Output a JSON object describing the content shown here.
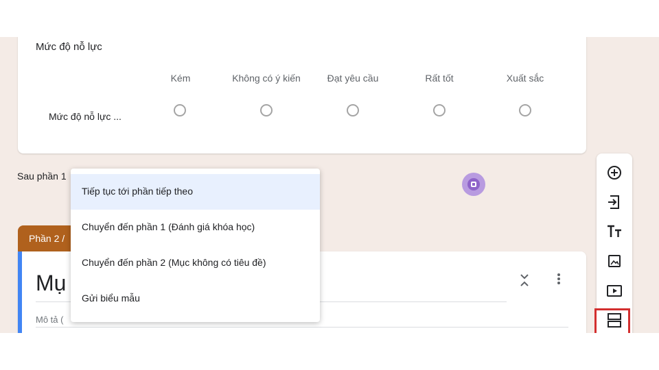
{
  "question": {
    "title": "Mức độ nỗ lực",
    "columns": [
      "Kém",
      "Không có ý kiến",
      "Đạt yêu cầu",
      "Rất tốt",
      "Xuất sắc"
    ],
    "row_label": "Mức độ nỗ lực ..."
  },
  "after_section_label": "Sau phần 1",
  "dropdown": {
    "options": [
      "Tiếp tục tới phần tiếp theo",
      "Chuyển đến phần 1 (Đánh giá khóa học)",
      "Chuyển đến phần 2 (Mục không có tiêu đề)",
      "Gửi biểu mẫu"
    ],
    "selected_index": 0
  },
  "section": {
    "tab_label": "Phần 2 /",
    "title": "Mụ",
    "description": "Mô tả ("
  },
  "toolbar": {
    "tools": [
      "add-question-icon",
      "import-questions-icon",
      "add-title-icon",
      "add-image-icon",
      "add-video-icon",
      "add-section-icon"
    ]
  },
  "colors": {
    "background": "#f4ebe6",
    "section_tab": "#b0611d",
    "accent": "#4285f4",
    "highlight": "#d32f2f",
    "selected_option": "#e8f0fe"
  }
}
